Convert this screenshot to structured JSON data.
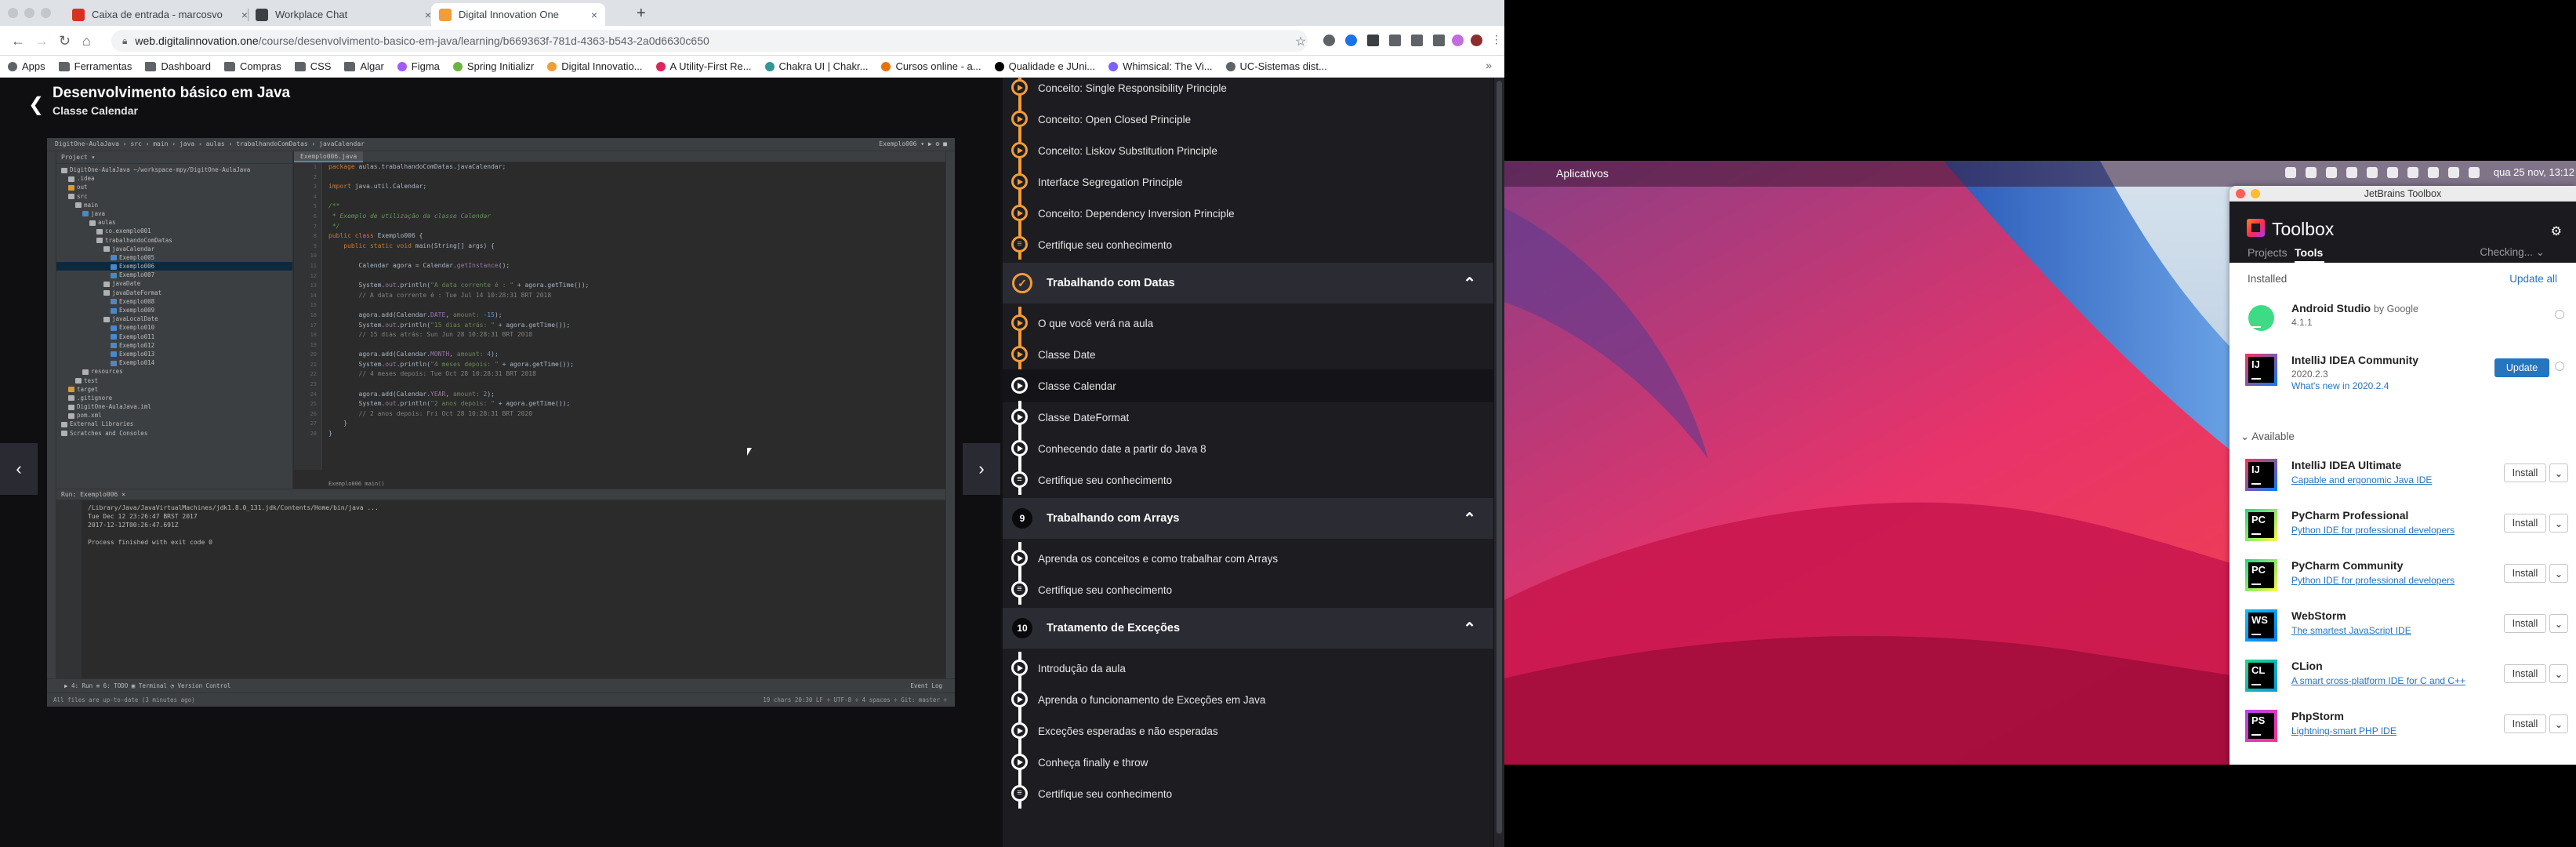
{
  "chrome": {
    "tabs": [
      {
        "label": "Caixa de entrada - marcosvo",
        "favicon": "gmail-icon",
        "color": "#d93025"
      },
      {
        "label": "Workplace Chat",
        "favicon": "workplace-icon",
        "color": "#3c4043"
      },
      {
        "label": "Digital Innovation One",
        "favicon": "dio-icon",
        "color": "#f19d38"
      }
    ],
    "url_host": "web.digitalinnovation.one",
    "url_path": "/course/desenvolvimento-basico-em-java/learning/b669363f-781d-4363-b543-2a0d6630c650",
    "bookmarks": [
      {
        "label": "Apps",
        "icon": "apps-icon",
        "color": "#5f6368"
      },
      {
        "label": "Ferramentas",
        "icon": "folder-icon",
        "color": "folder"
      },
      {
        "label": "Dashboard",
        "icon": "folder-icon",
        "color": "folder"
      },
      {
        "label": "Compras",
        "icon": "folder-icon",
        "color": "folder"
      },
      {
        "label": "CSS",
        "icon": "folder-icon",
        "color": "folder"
      },
      {
        "label": "Algar",
        "icon": "folder-icon",
        "color": "folder"
      },
      {
        "label": "Figma",
        "icon": "figma-icon",
        "color": "#a259ff"
      },
      {
        "label": "Spring Initializr",
        "icon": "spring-icon",
        "color": "#6db33f"
      },
      {
        "label": "Digital Innovatio...",
        "icon": "dio-icon",
        "color": "#f19d38"
      },
      {
        "label": "A Utility-First Re...",
        "icon": "tailwind-icon",
        "color": "#e0245e"
      },
      {
        "label": "Chakra UI | Chakr...",
        "icon": "chakra-icon",
        "color": "#319795"
      },
      {
        "label": "Cursos online - a...",
        "icon": "alura-icon",
        "color": "#e8710a"
      },
      {
        "label": "Qualidade e JUni...",
        "icon": "medium-icon",
        "color": "#000000"
      },
      {
        "label": "Whimsical: The Vi...",
        "icon": "whimsical-icon",
        "color": "#7b61ff"
      },
      {
        "label": "UC-Sistemas dist...",
        "icon": "globe-icon",
        "color": "#5f6368"
      }
    ]
  },
  "course": {
    "title": "Desenvolvimento básico em Java",
    "lesson": "Classe Calendar"
  },
  "ide": {
    "crumbs": "DigitOne-AulaJava  ›  src  ›  main  ›  java  ›  aulas  ›  trabalhandoComDatas  ›  javaCalendar",
    "run_config": "Exemplo006 ▾   ▶  ⚙  ■",
    "tab": "Exemplo006.java",
    "project_title": "Project ▾",
    "tree": [
      {
        "label": "DigitOne-AulaJava  ~/workspace-mpy/DigitOne-AulaJava",
        "indent": 0,
        "color": "#afb1b3"
      },
      {
        "label": ".idea",
        "indent": 1,
        "color": "#afb1b3"
      },
      {
        "label": "out",
        "indent": 1,
        "color": "#d69d28"
      },
      {
        "label": "src",
        "indent": 1,
        "color": "#afb1b3"
      },
      {
        "label": "main",
        "indent": 2,
        "color": "#afb1b3"
      },
      {
        "label": "java",
        "indent": 3,
        "color": "#4a88c7"
      },
      {
        "label": "aulas",
        "indent": 4,
        "color": "#afb1b3"
      },
      {
        "label": "co.exemplo001",
        "indent": 5,
        "color": "#afb1b3"
      },
      {
        "label": "trabalhandoComDatas",
        "indent": 5,
        "color": "#afb1b3"
      },
      {
        "label": "javaCalendar",
        "indent": 6,
        "color": "#afb1b3"
      },
      {
        "label": "Exemplo005",
        "indent": 7,
        "color": "#4a88c7"
      },
      {
        "label": "Exemplo006",
        "indent": 7,
        "color": "#4a88c7",
        "selected": true
      },
      {
        "label": "Exemplo007",
        "indent": 7,
        "color": "#4a88c7"
      },
      {
        "label": "javaDate",
        "indent": 6,
        "color": "#afb1b3"
      },
      {
        "label": "javaDateFormat",
        "indent": 6,
        "color": "#afb1b3"
      },
      {
        "label": "Exemplo008",
        "indent": 7,
        "color": "#4a88c7"
      },
      {
        "label": "Exemplo009",
        "indent": 7,
        "color": "#4a88c7"
      },
      {
        "label": "javaLocalDate",
        "indent": 6,
        "color": "#afb1b3"
      },
      {
        "label": "Exemplo010",
        "indent": 7,
        "color": "#4a88c7"
      },
      {
        "label": "Exemplo011",
        "indent": 7,
        "color": "#4a88c7"
      },
      {
        "label": "Exemplo012",
        "indent": 7,
        "color": "#4a88c7"
      },
      {
        "label": "Exemplo013",
        "indent": 7,
        "color": "#4a88c7"
      },
      {
        "label": "Exemplo014",
        "indent": 7,
        "color": "#4a88c7"
      },
      {
        "label": "resources",
        "indent": 3,
        "color": "#afb1b3"
      },
      {
        "label": "test",
        "indent": 2,
        "color": "#afb1b3"
      },
      {
        "label": "target",
        "indent": 1,
        "color": "#d69d28"
      },
      {
        "label": ".gitignore",
        "indent": 1,
        "color": "#afb1b3"
      },
      {
        "label": "DigitOne-AulaJava.iml",
        "indent": 1,
        "color": "#afb1b3"
      },
      {
        "label": "pom.xml",
        "indent": 1,
        "color": "#afb1b3"
      },
      {
        "label": "External Libraries",
        "indent": 0,
        "color": "#afb1b3"
      },
      {
        "label": "Scratches and Consoles",
        "indent": 0,
        "color": "#afb1b3"
      }
    ],
    "code": [
      [
        [
          "k",
          "package "
        ],
        [
          "t",
          "aulas.trabalhandoComDatas.javaCalendar;"
        ]
      ],
      [],
      [
        [
          "k",
          "import "
        ],
        [
          "t",
          "java.util.Calendar;"
        ]
      ],
      [],
      [
        [
          "cm",
          "/**"
        ]
      ],
      [
        [
          "cm",
          " * Exemplo de utilização da classe Calendar"
        ]
      ],
      [
        [
          "cm",
          " */"
        ]
      ],
      [
        [
          "k",
          "public class "
        ],
        [
          "t",
          "Exemplo006 {"
        ]
      ],
      [
        [
          "t",
          "    "
        ],
        [
          "k",
          "public static void "
        ],
        [
          "t",
          "main(String[] args) {"
        ]
      ],
      [],
      [
        [
          "t",
          "        Calendar agora = Calendar."
        ],
        [
          "f",
          "getInstance"
        ],
        [
          "t",
          "();"
        ]
      ],
      [],
      [
        [
          "t",
          "        System."
        ],
        [
          "f",
          "out"
        ],
        [
          "t",
          ".println("
        ],
        [
          "s",
          "\"A data corrente é : \""
        ],
        [
          "t",
          " + agora.getTime());"
        ]
      ],
      [
        [
          "c",
          "        // A data corrente é : Tue Jul 14 10:28:31 BRT 2018"
        ]
      ],
      [],
      [
        [
          "t",
          "        agora.add(Calendar."
        ],
        [
          "f",
          "DATE"
        ],
        [
          "t",
          ", "
        ],
        [
          "s",
          "amount: "
        ],
        [
          "n",
          "-15"
        ],
        [
          "t",
          ");"
        ]
      ],
      [
        [
          "t",
          "        System."
        ],
        [
          "f",
          "out"
        ],
        [
          "t",
          ".println("
        ],
        [
          "s",
          "\"15 dias atrás: \""
        ],
        [
          "t",
          " + agora.getTime());"
        ]
      ],
      [
        [
          "c",
          "        // 15 dias atrás: Sun Jun 28 10:28:31 BRT 2018"
        ]
      ],
      [],
      [
        [
          "t",
          "        agora.add(Calendar."
        ],
        [
          "f",
          "MONTH"
        ],
        [
          "t",
          ", "
        ],
        [
          "s",
          "amount: "
        ],
        [
          "n",
          "4"
        ],
        [
          "t",
          ");"
        ]
      ],
      [
        [
          "t",
          "        System."
        ],
        [
          "f",
          "out"
        ],
        [
          "t",
          ".println("
        ],
        [
          "s",
          "\"4 meses depois: \""
        ],
        [
          "t",
          " + agora.getTime());"
        ]
      ],
      [
        [
          "c",
          "        // 4 meses depois: Tue Oct 28 10:28:31 BRT 2018"
        ]
      ],
      [],
      [
        [
          "t",
          "        agora.add(Calendar."
        ],
        [
          "f",
          "YEAR"
        ],
        [
          "t",
          ", "
        ],
        [
          "s",
          "amount: "
        ],
        [
          "n",
          "2"
        ],
        [
          "t",
          ");"
        ]
      ],
      [
        [
          "t",
          "        System."
        ],
        [
          "f",
          "out"
        ],
        [
          "t",
          ".println("
        ],
        [
          "s",
          "\"2 anos depois: \""
        ],
        [
          "t",
          " + agora.getTime());"
        ]
      ],
      [
        [
          "c",
          "        // 2 anos depois: Fri Oct 28 10:28:31 BRT 2020"
        ]
      ],
      [
        [
          "t",
          "    }"
        ]
      ],
      [
        [
          "t",
          "}"
        ]
      ]
    ],
    "editor_crumb": "Exemplo006    main()",
    "run_head": "Run:    Exemplo006 ×",
    "run_output": [
      "/Library/Java/JavaVirtualMachines/jdk1.8.0_131.jdk/Contents/Home/bin/java ...",
      "Tue Dec 12 23:26:47 BRST 2017",
      "2017-12-12T00:26:47.691Z",
      "",
      "Process finished with exit code 0"
    ],
    "bottom_tools": "▶ 4: Run    ≡ 6: TODO    ▣ Terminal    ◔ Version Control",
    "bottom_right": "Event Log",
    "status_left": "All files are up-to-date (3 minutes ago)",
    "status_right": "19 chars    20:30    LF ÷    UTF-8 ÷    4 spaces ÷    Git: master ÷"
  },
  "lessons": {
    "items": [
      {
        "label": "Conceito: Single Responsibility Principle",
        "type": "video",
        "state": "done"
      },
      {
        "label": "Conceito: Open Closed Principle",
        "type": "video",
        "state": "done"
      },
      {
        "label": "Conceito: Liskov Substitution Principle",
        "type": "video",
        "state": "done"
      },
      {
        "label": "Interface Segregation Principle",
        "type": "video",
        "state": "done"
      },
      {
        "label": "Conceito: Dependency Inversion Principle",
        "type": "video",
        "state": "done"
      },
      {
        "label": "Certifique seu conhecimento",
        "type": "quiz",
        "state": "done"
      }
    ],
    "sections": [
      {
        "num": "✓",
        "title": "Trabalhando com Datas",
        "done": true,
        "items": [
          {
            "label": "O que você verá na aula",
            "type": "video",
            "state": "done"
          },
          {
            "label": "Classe Date",
            "type": "video",
            "state": "done"
          },
          {
            "label": "Classe Calendar",
            "type": "video",
            "state": "current"
          },
          {
            "label": "Classe DateFormat",
            "type": "video",
            "state": "todo"
          },
          {
            "label": "Conhecendo date a partir do Java 8",
            "type": "video",
            "state": "todo"
          },
          {
            "label": "Certifique seu conhecimento",
            "type": "quiz",
            "state": "todo"
          }
        ]
      },
      {
        "num": "9",
        "title": "Trabalhando com Arrays",
        "done": false,
        "items": [
          {
            "label": "Aprenda os conceitos e como trabalhar com Arrays",
            "type": "video",
            "state": "todo"
          },
          {
            "label": "Certifique seu conhecimento",
            "type": "quiz",
            "state": "todo"
          }
        ]
      },
      {
        "num": "10",
        "title": "Tratamento de Exceções",
        "done": false,
        "items": [
          {
            "label": "Introdução da aula",
            "type": "video",
            "state": "todo"
          },
          {
            "label": "Aprenda o funcionamento de Exceções em Java",
            "type": "video",
            "state": "todo"
          },
          {
            "label": "Exceções esperadas e não esperadas",
            "type": "video",
            "state": "todo"
          },
          {
            "label": "Conheça finally e throw",
            "type": "video",
            "state": "todo"
          },
          {
            "label": "Certifique seu conhecimento",
            "type": "quiz",
            "state": "todo"
          }
        ]
      }
    ]
  },
  "mac": {
    "menu_app": "Aplicativos",
    "clock": "qua 25 nov, 13:12"
  },
  "toolbox": {
    "window_title": "JetBrains Toolbox",
    "name": "Toolbox",
    "tab_projects": "Projects",
    "tab_tools": "Tools",
    "checking": "Checking... ⌄",
    "installed_label": "Installed",
    "update_all": "Update all",
    "available_label": "Available",
    "installed": [
      {
        "name": "Android Studio",
        "by": "by Google",
        "version": "4.1.1",
        "icon_text": "",
        "icon_colors": [
          "#3ddc84",
          "#4285f4"
        ]
      },
      {
        "name": "IntelliJ IDEA Community",
        "version": "2020.2.3",
        "note": "What's new in 2020.2.4",
        "button": "Update",
        "icon_text": "IJ",
        "icon_colors": [
          "#fe315d",
          "#087cfa"
        ]
      }
    ],
    "available": [
      {
        "name": "IntelliJ IDEA Ultimate",
        "desc": "Capable and ergonomic Java IDE",
        "icon_text": "IJ",
        "icon_colors": [
          "#fe315d",
          "#087cfa"
        ]
      },
      {
        "name": "PyCharm Professional",
        "desc": "Python IDE for professional developers",
        "icon_text": "PC",
        "icon_colors": [
          "#21d789",
          "#fcf84a"
        ]
      },
      {
        "name": "PyCharm Community",
        "desc": "Python IDE for professional developers",
        "icon_text": "PC",
        "icon_colors": [
          "#21d789",
          "#fcf84a"
        ]
      },
      {
        "name": "WebStorm",
        "desc": "The smartest JavaScript IDE",
        "icon_text": "WS",
        "icon_colors": [
          "#07c3f2",
          "#087cfa"
        ]
      },
      {
        "name": "CLion",
        "desc": "A smart cross-platform IDE for C and C++",
        "icon_text": "CL",
        "icon_colors": [
          "#21d789",
          "#009ae5"
        ]
      },
      {
        "name": "PhpStorm",
        "desc": "Lightning-smart PHP IDE",
        "icon_text": "PS",
        "icon_colors": [
          "#b345f1",
          "#ff318c"
        ]
      }
    ],
    "install_label": "Install"
  }
}
